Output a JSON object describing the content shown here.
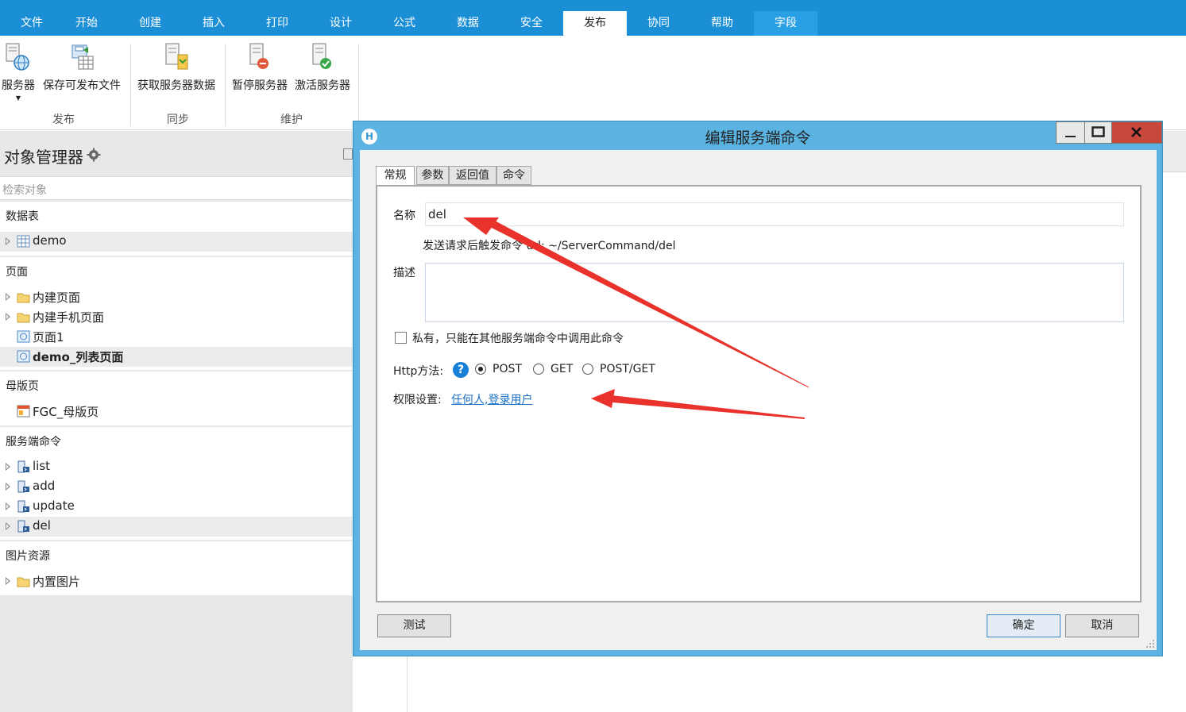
{
  "ribbon_tabs": [
    "文件",
    "开始",
    "创建",
    "插入",
    "打印",
    "设计",
    "公式",
    "数据",
    "安全",
    "发布",
    "协同",
    "帮助",
    "字段"
  ],
  "active_tab": "发布",
  "ribbon": {
    "publish": {
      "server_label": "服务器",
      "save_publish_label": "保存可发布文件",
      "group_label": "发布"
    },
    "sync": {
      "fetch_label": "获取服务器数据",
      "group_label": "同步"
    },
    "maintain": {
      "pause_label": "暂停服务器",
      "activate_label": "激活服务器",
      "group_label": "维护"
    }
  },
  "object_manager": {
    "title": "对象管理器",
    "search_placeholder": "检索对象",
    "tables": {
      "title": "数据表",
      "items": [
        "demo"
      ]
    },
    "pages": {
      "title": "页面",
      "items": [
        "内建页面",
        "内建手机页面",
        "页面1",
        "demo_列表页面"
      ]
    },
    "master": {
      "title": "母版页",
      "items": [
        "FGC_母版页"
      ]
    },
    "commands": {
      "title": "服务端命令",
      "items": [
        "list",
        "add",
        "update",
        "del"
      ]
    },
    "images": {
      "title": "图片资源",
      "items": [
        "内置图片"
      ]
    }
  },
  "dialog": {
    "title": "编辑服务端命令",
    "tabs": [
      "常规",
      "参数",
      "返回值",
      "命令"
    ],
    "active_tab": "常规",
    "name_label": "名称",
    "name_value": "del",
    "url_hint": "发送请求后触发命令 url: ~/ServerCommand/del",
    "desc_label": "描述",
    "desc_value": "",
    "private_label": "私有，只能在其他服务端命令中调用此命令",
    "private_checked": false,
    "http_label": "Http方法:",
    "http_options": [
      "POST",
      "GET",
      "POST/GET"
    ],
    "http_selected": "POST",
    "permission_label": "权限设置:",
    "permission_value": "任何人,登录用户",
    "test_button": "测试",
    "ok_button": "确定",
    "cancel_button": "取消"
  },
  "colors": {
    "ribbon_blue": "#1a8fd6",
    "dialog_frame": "#5ab3e0",
    "close_red": "#c9483c",
    "link_blue": "#1a6fc6",
    "annotation_arrow": "#e8322b"
  }
}
